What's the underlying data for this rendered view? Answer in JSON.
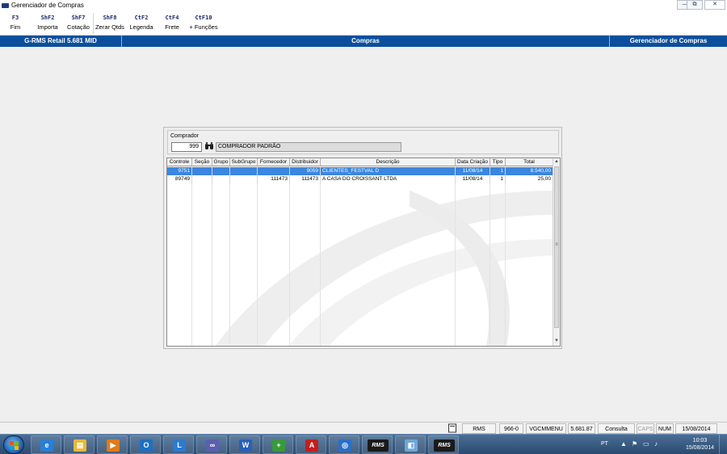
{
  "window": {
    "title": "Gerenciador de Compras",
    "controls": {
      "minimize": "—",
      "maximize": "⧉",
      "close": "✕"
    }
  },
  "toolbar": {
    "items": [
      {
        "key": "F3",
        "label": "Fim"
      },
      {
        "key": "ShF2",
        "label": "Importa"
      },
      {
        "key": "ShF7",
        "label": "Cotação"
      },
      {
        "key": "ShF8",
        "label": "Zerar Qtds"
      },
      {
        "key": "CtF2",
        "label": "Legenda"
      },
      {
        "key": "CtF4",
        "label": "Frete"
      },
      {
        "key": "CtF10",
        "label": "+ Funções"
      }
    ]
  },
  "header": {
    "system": "G-RMS Retail 5.681 MID",
    "module": "Compras",
    "screen": "Gerenciador de Compras"
  },
  "comprador": {
    "label": "Comprador",
    "code": "999",
    "name": "COMPRADOR PADRÃO",
    "search_icon": "binoculars-icon"
  },
  "grid": {
    "columns": [
      "Controle",
      "Seção",
      "Grupo",
      "SubGrupo",
      "Fornecedor",
      "Distribuidor",
      "Descrição",
      "Data Criação",
      "Tipo",
      "Total"
    ],
    "rows": [
      {
        "controle": "9751",
        "secao": "",
        "grupo": "",
        "subgrupo": "",
        "fornecedor": "",
        "distribuidor": "9059",
        "descricao": "CLIENTES_FESTVAL D",
        "data_criacao": "11/08/14",
        "tipo": "1",
        "total": "8.540,00",
        "selected": true
      },
      {
        "controle": "89749",
        "secao": "",
        "grupo": "",
        "subgrupo": "",
        "fornecedor": "111473",
        "distribuidor": "111473",
        "descricao": "A CASA DO CROISSANT LTDA",
        "data_criacao": "11/08/14",
        "tipo": "1",
        "total": "25,00",
        "selected": false
      }
    ],
    "scroll": {
      "up": "▲",
      "down": "▼",
      "grip": "≡"
    }
  },
  "statusbar": {
    "items": [
      "RMS",
      "966-0",
      "VGCMMENU",
      "5.681.87",
      "Consulta",
      "CAPS",
      "NUM",
      "15/08/2014"
    ]
  },
  "taskbar": {
    "apps": [
      {
        "name": "internet-explorer",
        "glyph": "e",
        "color": "#2a7fd4"
      },
      {
        "name": "file-explorer",
        "glyph": "▤",
        "color": "#e8b93a"
      },
      {
        "name": "media-player",
        "glyph": "▶",
        "color": "#e07a1a"
      },
      {
        "name": "outlook",
        "glyph": "O",
        "color": "#1f6fc1"
      },
      {
        "name": "lync",
        "glyph": "L",
        "color": "#2b7bd0"
      },
      {
        "name": "link-app",
        "glyph": "∞",
        "color": "#5a5fb0"
      },
      {
        "name": "word",
        "glyph": "W",
        "color": "#2b5fb5"
      },
      {
        "name": "install-app",
        "glyph": "+",
        "color": "#3a9a3a"
      },
      {
        "name": "acrobat",
        "glyph": "A",
        "color": "#c41e1e"
      },
      {
        "name": "remote-app",
        "glyph": "◎",
        "color": "#2a6fc9"
      },
      {
        "name": "rms-app",
        "glyph": "RMS",
        "color": "#1a1a1a"
      },
      {
        "name": "window-app",
        "glyph": "◧",
        "color": "#6fa7d8"
      },
      {
        "name": "rms-app-2",
        "glyph": "RMS",
        "color": "#1a1a1a"
      }
    ],
    "tray": {
      "lang": "PT",
      "time": "10:03",
      "date": "15/08/2014"
    }
  }
}
